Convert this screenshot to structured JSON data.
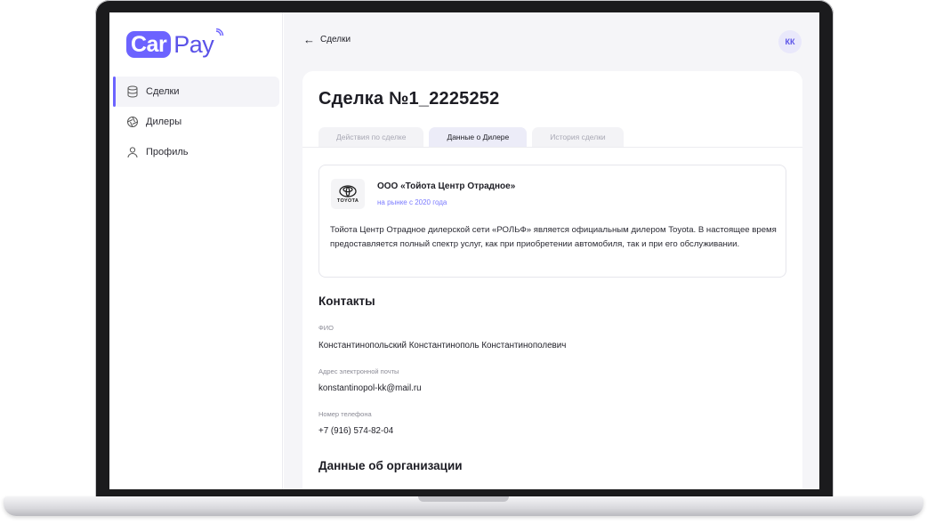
{
  "app": {
    "logo_left": "Car",
    "logo_right": "Pay"
  },
  "sidebar": {
    "items": [
      {
        "label": "Сделки",
        "icon": "database-icon",
        "active": true
      },
      {
        "label": "Дилеры",
        "icon": "aperture-icon",
        "active": false
      },
      {
        "label": "Профиль",
        "icon": "user-icon",
        "active": false
      }
    ]
  },
  "header": {
    "back_label": "Сделки",
    "avatar_initials": "КК"
  },
  "deal": {
    "title": "Сделка №1_2225252",
    "tabs": [
      {
        "label": "Действия по сделке",
        "active": false
      },
      {
        "label": "Данные о Дилере",
        "active": true
      },
      {
        "label": "История сделки",
        "active": false
      }
    ]
  },
  "dealer": {
    "logo_text": "TOYOTA",
    "name": "ООО «Тойота Центр Отрадное»",
    "since": "на рынке с 2020 года",
    "description": "Тойота Центр Отрадное дилерской сети «РОЛЬФ» является официальным дилером Toyota. В настоящее время предоставляется полный спектр услуг, как при приобретении автомобиля, так и при его обслуживании."
  },
  "contacts": {
    "title": "Контакты",
    "fio_label": "ФИО",
    "fio_value": "Константинопольский Константинополь Константинополевич",
    "email_label": "Адрес электронной почты",
    "email_value": "konstantinopol-kk@mail.ru",
    "phone_label": "Номер телефона",
    "phone_value": "+7 (916) 574-82-04"
  },
  "organization": {
    "title": "Данные об организации"
  },
  "colors": {
    "accent": "#6c63ff",
    "background": "#f5f5f8"
  }
}
